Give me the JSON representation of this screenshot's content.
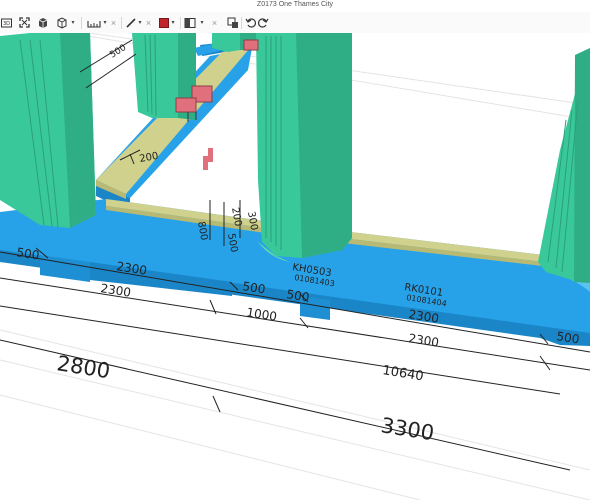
{
  "window": {
    "title": "Z0173 One Thames City"
  },
  "toolbar": {
    "icons": [
      "view-3d-icon",
      "fit-view-icon",
      "objects-icon",
      "cube-icon",
      "measure-icon",
      "line-icon",
      "color-icon",
      "clip-icon",
      "undo-icon",
      "redo-icon",
      "model-tree-icon"
    ],
    "accent_color": "#c0252b"
  },
  "model": {
    "colors": {
      "slab": "#27a2e8",
      "column": "#39c89a",
      "beam": "#cfd18c",
      "plate": "#e0707c"
    },
    "dimensions": {
      "d_500_a": "500",
      "d_2300_a": "2300",
      "d_500_b": "500",
      "d_500_c": "500",
      "d_500_d": "500",
      "d_2300_b": "2300",
      "d_1000": "1000",
      "d_2300_c": "2300",
      "d_10640": "10640",
      "d_2800": "2800",
      "d_3300": "3300",
      "d_2300_d": "2300",
      "d_200_a": "200",
      "d_200_b": "200",
      "d_300": "300",
      "d_800": "800",
      "d_500_e": "500",
      "d_500_f": "500"
    },
    "labels": {
      "mark_a": "KH0503",
      "mark_a_id": "01081403",
      "mark_b": "RK0101",
      "mark_b_id": "01081404"
    }
  }
}
